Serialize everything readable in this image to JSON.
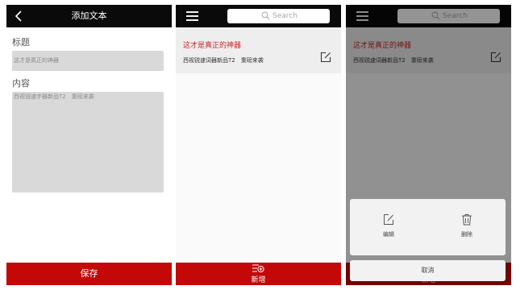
{
  "add_screen": {
    "title": "添加文本",
    "title_label": "标题",
    "title_value": "这才是真正的神器",
    "content_label": "内容",
    "content_value": "西视锐速字器新品T2　重磅来袭",
    "save_label": "保存"
  },
  "list_screen": {
    "search_placeholder": "Search",
    "notes": [
      {
        "title": "这才是真正的神器",
        "body": "西视锐速词器新品T2　重磅来袭"
      }
    ],
    "add_label": "新增"
  },
  "action_screen": {
    "search_placeholder": "Search",
    "notes": [
      {
        "title": "这才是真正的神器",
        "body": "西视锐速词器新品T2　重磅来袭"
      }
    ],
    "add_label": "新增",
    "sheet": {
      "edit_label": "编辑",
      "delete_label": "删除",
      "cancel_label": "取消"
    }
  },
  "colors": {
    "topbar": "#0a0a0a",
    "bottombar": "#c40808",
    "note_title": "#c62828",
    "input_bg": "#d9d9d9"
  }
}
